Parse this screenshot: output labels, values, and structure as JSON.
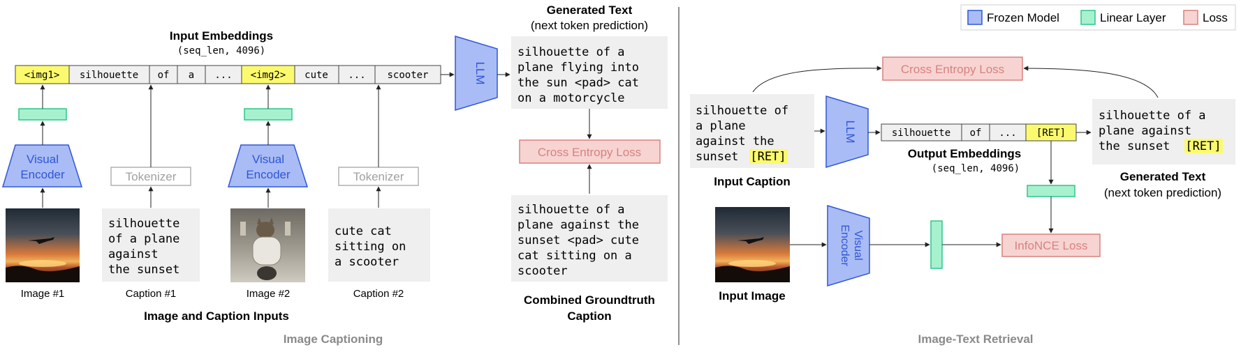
{
  "legend": [
    {
      "label": "Frozen Model",
      "color": "#aabcf5",
      "border": "#2f56d6"
    },
    {
      "label": "Linear Layer",
      "color": "#a7f1cf",
      "border": "#2fc58b"
    },
    {
      "label": "Loss",
      "color": "#f7d4d2",
      "border": "#d78280"
    }
  ],
  "captioning": {
    "title": "Image Captioning",
    "input_embeddings": {
      "title": "Input Embeddings",
      "shape": "(seq_len, 4096)",
      "tokens": [
        "<img1>",
        "silhouette",
        "of",
        "a",
        "...",
        "<img2>",
        "cute",
        "...",
        "scooter"
      ]
    },
    "llm": "LLM",
    "generated_text": {
      "title": "Generated Text",
      "subtitle": "(next token prediction)",
      "lines": [
        "silhouette of a",
        "plane flying into",
        "the sun <pad> cat",
        "on a motorcycle"
      ]
    },
    "loss": "Cross Entropy Loss",
    "groundtruth": {
      "lines": [
        "silhouette of a",
        "plane against the",
        "sunset <pad> cute",
        "cat sitting on a",
        "scooter"
      ],
      "label_line1": "Combined Groundtruth",
      "label_line2": "Caption"
    },
    "visual_encoder_line1": "Visual",
    "visual_encoder_line2": "Encoder",
    "tokenizer": "Tokenizer",
    "caption1_lines": [
      "silhouette",
      "of a plane",
      "against",
      "the sunset"
    ],
    "caption2_lines": [
      "cute cat",
      "sitting on",
      "a scooter"
    ],
    "image1_label": "Image #1",
    "caption1_label": "Caption #1",
    "image2_label": "Image #2",
    "caption2_label": "Caption #2",
    "inputs_label": "Image and Caption Inputs"
  },
  "retrieval": {
    "title": "Image-Text Retrieval",
    "loss_top": "Cross Entropy Loss",
    "input_caption_lines": [
      "silhouette of",
      "a plane",
      "against the",
      "sunset"
    ],
    "ret_token": "[RET]",
    "input_caption_label": "Input Caption",
    "llm": "LLM",
    "output_tokens": [
      "silhouette",
      "of",
      "...",
      "[RET]"
    ],
    "output_embeddings": {
      "title": "Output Embeddings",
      "shape": "(seq_len, 4096)"
    },
    "generated_lines": [
      "silhouette of a",
      "plane against",
      "the sunset"
    ],
    "generated_label": "Generated Text",
    "generated_sub": "(next token prediction)",
    "visual_encoder_line1": "Visual",
    "visual_encoder_line2": "Encoder",
    "input_image_label": "Input Image",
    "infonce": "InfoNCE Loss"
  }
}
